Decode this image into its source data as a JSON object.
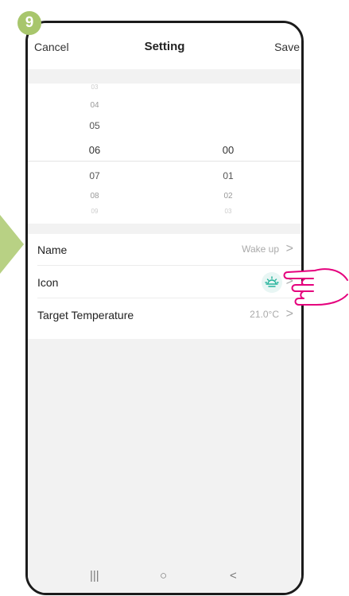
{
  "step_number": "9",
  "header": {
    "cancel_label": "Cancel",
    "title": "Setting",
    "save_label": "Save"
  },
  "picker": {
    "hours": [
      "03",
      "04",
      "05",
      "06",
      "07",
      "08",
      "09"
    ],
    "minutes": [
      "00",
      "01",
      "02",
      "03"
    ],
    "selected_hour": "06",
    "selected_minute": "00"
  },
  "rows": [
    {
      "label": "Name",
      "value": "Wake up"
    },
    {
      "label": "Icon",
      "value": ""
    },
    {
      "label": "Target Temperature",
      "value": "21.0°C"
    }
  ],
  "chevron": ">",
  "icons": {
    "row_icon": "sunrise-icon",
    "hand": "pointing-hand-icon"
  },
  "colors": {
    "badge": "#a8c66c",
    "arrow": "#b8d184",
    "icon_accent": "#26b39b",
    "hand": "#e5007d"
  },
  "navbar": {
    "recent": "|||",
    "home": "○",
    "back": "<"
  }
}
